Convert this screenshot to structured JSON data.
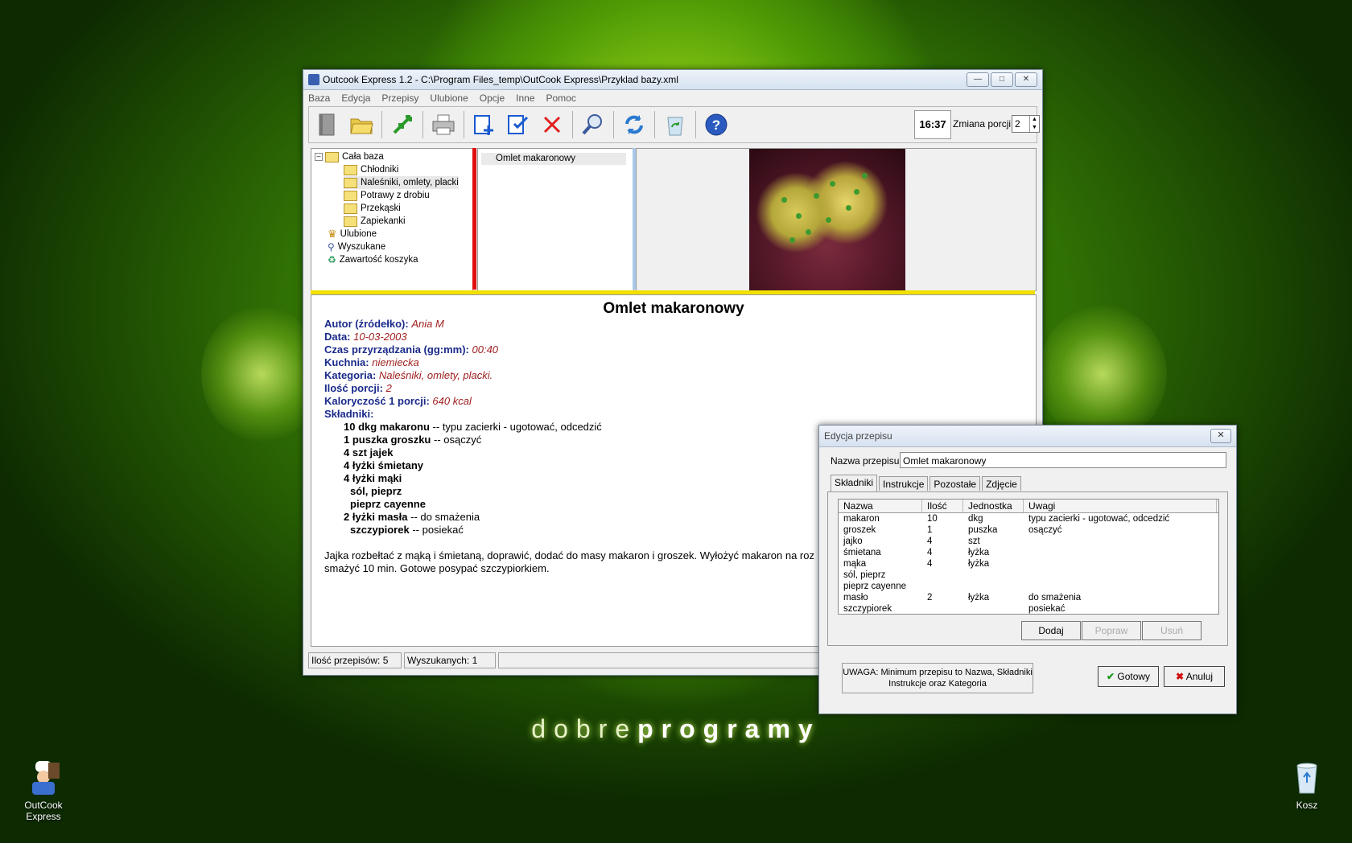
{
  "desktop": {
    "brand_light": "dobre",
    "brand_bold": "programy",
    "icons": [
      {
        "label": "OutCook Express",
        "icon": "chef-app-icon"
      },
      {
        "label": "Kosz",
        "icon": "recycle-bin-icon"
      }
    ]
  },
  "main_window": {
    "title": "Outcook Express 1.2 - C:\\Program Files_temp\\OutCook Express\\Przyklad bazy.xml",
    "menu": [
      "Baza",
      "Edycja",
      "Przepisy",
      "Ulubione",
      "Opcje",
      "Inne",
      "Pomoc"
    ],
    "toolbar": {
      "icons": [
        "book-icon",
        "open-folder-icon",
        "move-arrows-icon",
        "printer-icon",
        "add-recipe-icon",
        "edit-recipe-icon",
        "delete-icon",
        "search-icon",
        "refresh-icon",
        "recycle-icon",
        "help-icon"
      ],
      "clock": "16:37",
      "portion_label": "Zmiana porcji",
      "portion_value": "2"
    },
    "tree": {
      "root": "Cała baza",
      "categories": [
        "Chłodniki",
        "Naleśniki, omlety, placki",
        "Potrawy z drobiu",
        "Przekąski",
        "Zapiekanki"
      ],
      "extras": [
        "Ulubione",
        "Wyszukane",
        "Zawartość koszyka"
      ]
    },
    "recipe_list": [
      "Omlet makaronowy"
    ],
    "recipe": {
      "title": "Omlet makaronowy",
      "fields": [
        {
          "label": "Autor (źródełko):",
          "value": "Ania M"
        },
        {
          "label": "Data:",
          "value": "10-03-2003"
        },
        {
          "label": "Czas przyrządzania (gg:mm):",
          "value": "00:40"
        },
        {
          "label": "Kuchnia:",
          "value": "niemiecka"
        },
        {
          "label": "Kategoria:",
          "value": "Naleśniki, omlety, placki."
        },
        {
          "label": "Ilość porcji:",
          "value": "2"
        },
        {
          "label": "Kaloryczość 1 porcji:",
          "value": "640 kcal"
        }
      ],
      "ingredients_label": "Składniki:",
      "ingredients": [
        {
          "bold": "10 dkg makaronu",
          "note": " -- typu zacierki - ugotować, odcedzić"
        },
        {
          "bold": "1 puszka groszku",
          "note": " -- osączyć"
        },
        {
          "bold": "4 szt jajek",
          "note": ""
        },
        {
          "bold": "4 łyżki śmietany",
          "note": ""
        },
        {
          "bold": "4 łyżki mąki",
          "note": ""
        },
        {
          "bold": "sól, pieprz",
          "note": ""
        },
        {
          "bold": "pieprz cayenne",
          "note": ""
        },
        {
          "bold": "2 łyżki masła",
          "note": " -- do smażenia"
        },
        {
          "bold": "szczypiorek",
          "note": " -- posiekać"
        }
      ],
      "description_line1": "Jajka rozbełtać z mąką i śmietaną, doprawić, dodać do masy makaron i groszek. Wyłożyć makaron na roz",
      "description_line2": "smażyć 10 min. Gotowe posypać szczypiorkiem."
    },
    "status": {
      "count": "Ilość przepisów: 5",
      "found": "Wyszukanych: 1"
    }
  },
  "dialog": {
    "title": "Edycja przepisu",
    "name_label": "Nazwa przepisu:",
    "name_value": "Omlet makaronowy",
    "tabs": [
      "Składniki",
      "Instrukcje",
      "Pozostałe",
      "Zdjęcie"
    ],
    "columns": [
      "Nazwa",
      "Ilość",
      "Jednostka",
      "Uwagi"
    ],
    "rows": [
      [
        "makaron",
        "10",
        "dkg",
        "typu zacierki - ugotować, odcedzić"
      ],
      [
        "groszek",
        "1",
        "puszka",
        "osączyć"
      ],
      [
        "jajko",
        "4",
        "szt",
        ""
      ],
      [
        "śmietana",
        "4",
        "łyżka",
        ""
      ],
      [
        "mąka",
        "4",
        "łyżka",
        ""
      ],
      [
        "sól, pieprz",
        "",
        "",
        ""
      ],
      [
        "pieprz cayenne",
        "",
        "",
        ""
      ],
      [
        "masło",
        "2",
        "łyżka",
        "do smażenia"
      ],
      [
        "szczypiorek",
        "",
        "",
        "posiekać"
      ]
    ],
    "buttons": {
      "add": "Dodaj",
      "edit": "Popraw",
      "remove": "Usuń",
      "ok": "Gotowy",
      "cancel": "Anuluj"
    },
    "note_line1": "UWAGA: Minimum przepisu to Nazwa, Składniki",
    "note_line2": "Instrukcje oraz Kategoria"
  }
}
